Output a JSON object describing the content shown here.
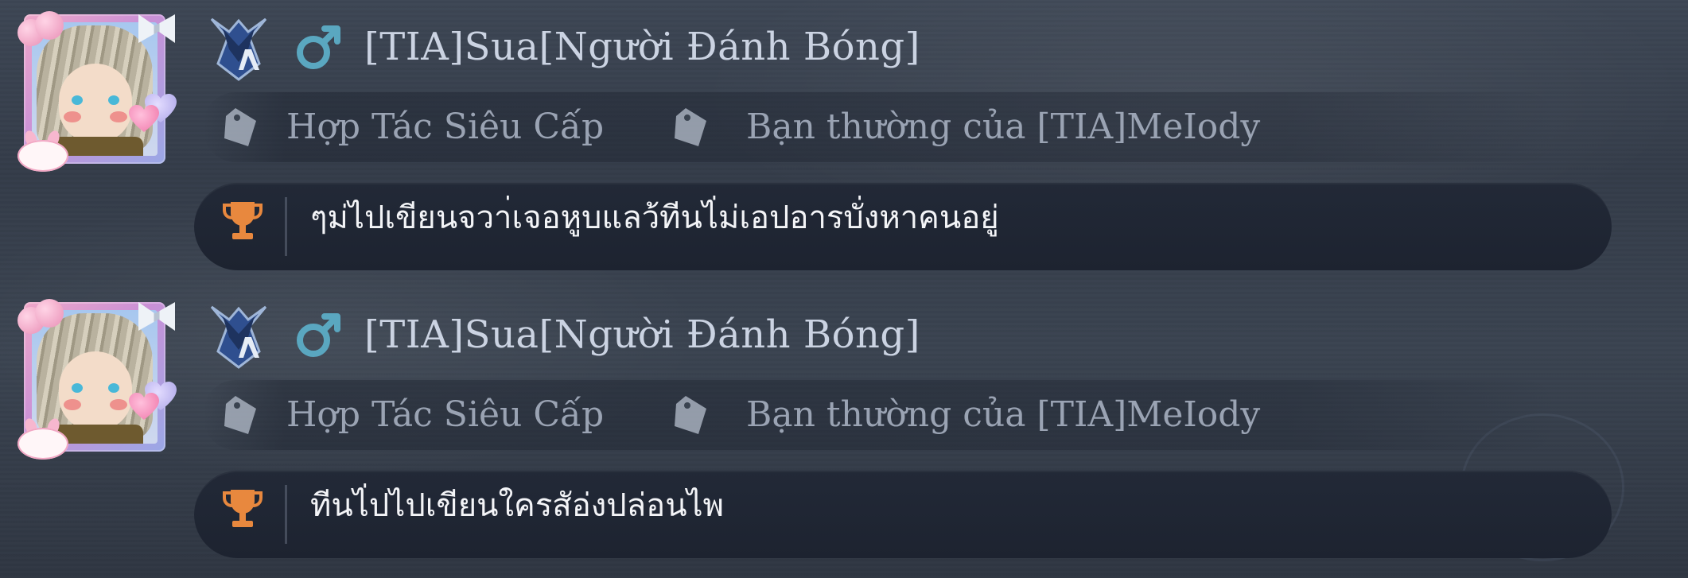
{
  "colors": {
    "username": "#cbd3e2",
    "tag_text": "#9aa3b3",
    "gender_icon": "#5aa7c0",
    "trophy_icon": "#e8883e",
    "signature_text": "#f3f4f7"
  },
  "messages": [
    {
      "username": "[TIA]Sua[Người Đánh Bóng]",
      "gender_icon": "male-symbol-icon",
      "rank_icon": "rank-v-badge-icon",
      "tags": [
        {
          "icon": "tag-icon",
          "label": "Hợp Tác Siêu Cấp"
        },
        {
          "icon": "tag-icon",
          "label": "Bạn thường của [TIA]MeIody"
        }
      ],
      "signature_icon": "trophy-icon",
      "signature": "ๆม่ไปเขียนจวา่เจอหูบแลว้ทีนไ่ม่เอปอารบั่งหาคนอยู่"
    },
    {
      "username": "[TIA]Sua[Người Đánh Bóng]",
      "gender_icon": "male-symbol-icon",
      "rank_icon": "rank-v-badge-icon",
      "tags": [
        {
          "icon": "tag-icon",
          "label": "Hợp Tác Siêu Cấp"
        },
        {
          "icon": "tag-icon",
          "label": "Bạn thường của [TIA]MeIody"
        }
      ],
      "signature_icon": "trophy-icon",
      "signature": "ทีนไ่ปไปเขียนใครสัอ่งปล่อนไพ"
    }
  ]
}
